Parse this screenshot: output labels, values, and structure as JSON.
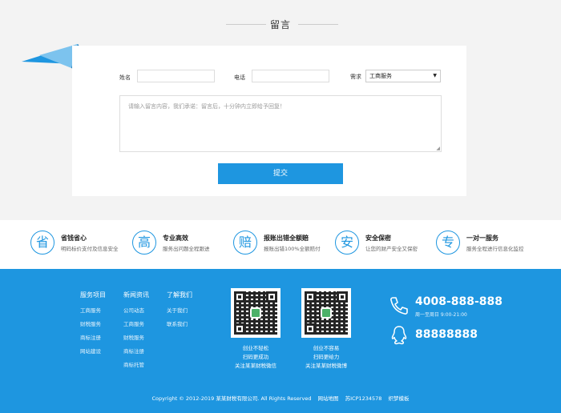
{
  "message": {
    "title": "留言",
    "name_label": "姓名",
    "phone_label": "电话",
    "need_label": "需求",
    "need_selected": "工商服务",
    "content_placeholder": "请输入留言内容，我们承诺：留言后，十分钟内立即给予回复！",
    "submit_label": "提交"
  },
  "features": [
    {
      "icon": "省",
      "icon_name": "save-icon",
      "title": "省钱省心",
      "desc": "明码标价支付及信息安全"
    },
    {
      "icon": "高",
      "icon_name": "efficiency-icon",
      "title": "专业高效",
      "desc": "服务出问题全程跟进"
    },
    {
      "icon": "赔",
      "icon_name": "compensation-icon",
      "title": "报账出错全额赔",
      "desc": "报账出错100%全额赔付"
    },
    {
      "icon": "安",
      "icon_name": "security-icon",
      "title": "安全保密",
      "desc": "让您的财产安全又保密"
    },
    {
      "icon": "专",
      "icon_name": "exclusive-icon",
      "title": "一对一服务",
      "desc": "服务全程进行信息化监控"
    }
  ],
  "footer": {
    "columns": [
      {
        "head": "服务项目",
        "items": [
          "工商服务",
          "财税服务",
          "商标注册",
          "网站建设"
        ]
      },
      {
        "head": "新闻资讯",
        "items": [
          "公司动态",
          "工商服务",
          "财税服务",
          "商标注册",
          "商标托管"
        ]
      },
      {
        "head": "了解我们",
        "items": [
          "关于我们",
          "联系我们"
        ]
      }
    ],
    "qr1_caption": [
      "创业不轻松",
      "扫码更成功",
      "关注某某财税微信"
    ],
    "qr2_caption": [
      "创业不容易",
      "扫码更给力",
      "关注某某财税微博"
    ],
    "phone": "4008-888-888",
    "hours": "周一至周日 9:00-21:00",
    "qq": "88888888",
    "copyright": "Copyright © 2012-2019 某某财税有限公司. All Rights Reserved",
    "sitemap": "网站地图",
    "icp": "苏ICP1234578",
    "template": "织梦模板"
  },
  "colors": {
    "accent": "#1e96e0",
    "section_bg": "#f3f3f3"
  }
}
